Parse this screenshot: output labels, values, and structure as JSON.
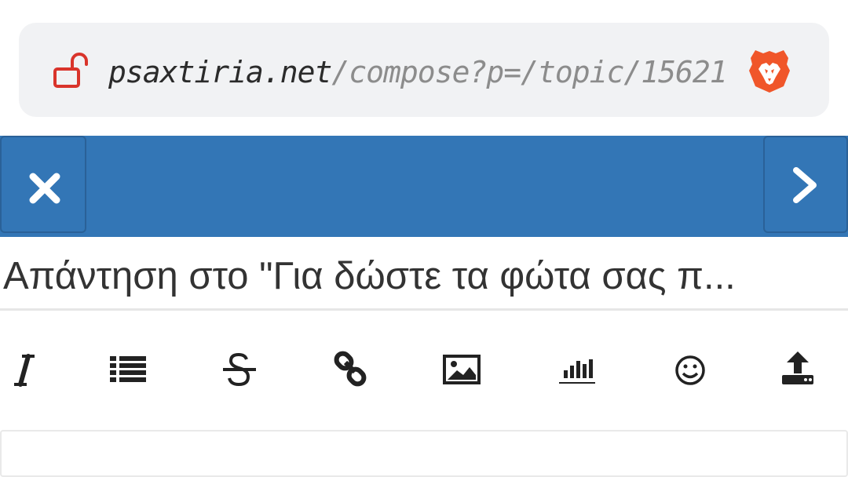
{
  "browser": {
    "url_domain": "psaxtiria.net",
    "url_path": "/compose?p=/topic/15621",
    "icons": {
      "lock": "lock-open-icon",
      "browser_logo": "brave-lion-icon"
    },
    "lock_color": "#d9342b",
    "brave_color": "#f0562a"
  },
  "header": {
    "background": "#3376b6",
    "icons": {
      "close": "close-icon",
      "next": "chevron-right-icon"
    }
  },
  "compose": {
    "title_value": "Απάντηση στο \"Για δώστε τα φώτα σας π...",
    "toolbar": [
      {
        "name": "italic-button",
        "icon": "italic-icon"
      },
      {
        "name": "list-button",
        "icon": "list-icon"
      },
      {
        "name": "strikethrough-button",
        "icon": "strikethrough-icon"
      },
      {
        "name": "link-button",
        "icon": "link-icon"
      },
      {
        "name": "image-button",
        "icon": "image-icon"
      },
      {
        "name": "poll-button",
        "icon": "bar-chart-icon"
      },
      {
        "name": "emoji-button",
        "icon": "smiley-icon"
      },
      {
        "name": "upload-button",
        "icon": "upload-icon"
      }
    ]
  }
}
